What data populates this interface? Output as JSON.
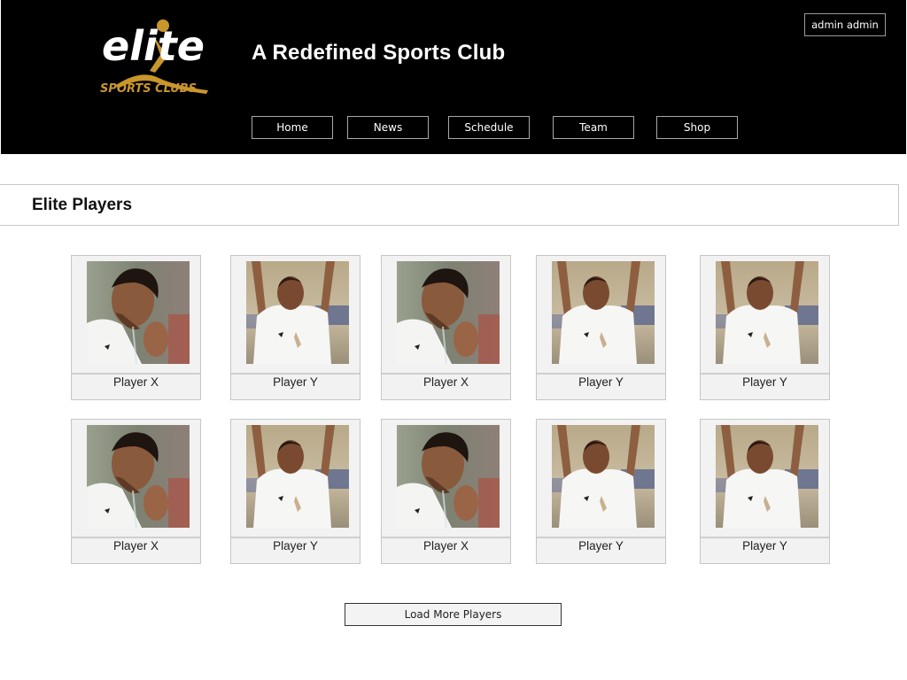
{
  "header": {
    "logo": {
      "word": "elite",
      "sub": "SPORTS CLUBS"
    },
    "title": "A Redefined Sports Club",
    "user_label": "admin admin",
    "nav": [
      {
        "label": "Home"
      },
      {
        "label": "News"
      },
      {
        "label": "Schedule"
      },
      {
        "label": "Team"
      },
      {
        "label": "Shop"
      }
    ]
  },
  "section": {
    "title": "Elite Players"
  },
  "players": [
    {
      "name": "Player X",
      "photo": "player-bowed-head"
    },
    {
      "name": "Player Y",
      "photo": "player-arms-raised"
    },
    {
      "name": "Player X",
      "photo": "player-bowed-head"
    },
    {
      "name": "Player Y",
      "photo": "player-arms-raised"
    },
    {
      "name": "Player Y",
      "photo": "player-arms-raised"
    },
    {
      "name": "Player X",
      "photo": "player-bowed-head"
    },
    {
      "name": "Player Y",
      "photo": "player-arms-raised"
    },
    {
      "name": "Player X",
      "photo": "player-bowed-head"
    },
    {
      "name": "Player Y",
      "photo": "player-arms-raised"
    },
    {
      "name": "Player Y",
      "photo": "player-arms-raised"
    }
  ],
  "load_more_label": "Load More Players",
  "colors": {
    "header_bg": "#000000",
    "logo_gold": "#c9962c",
    "card_bg": "#f2f2f2"
  }
}
